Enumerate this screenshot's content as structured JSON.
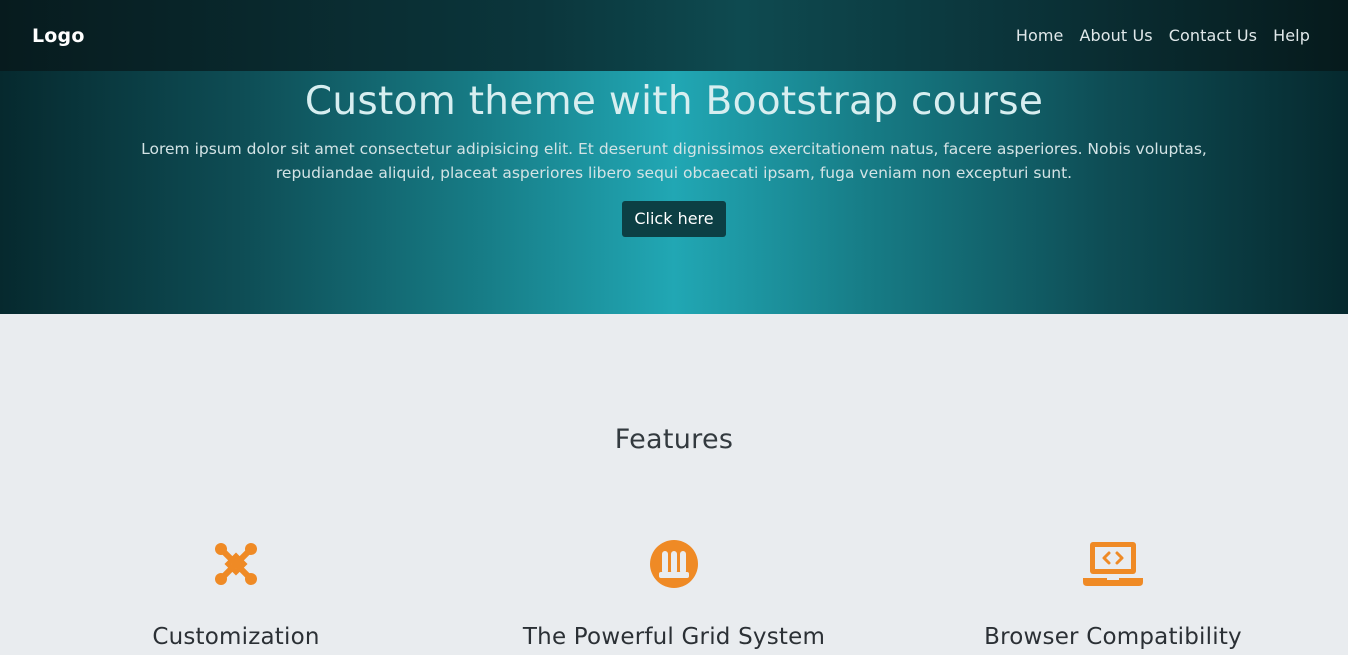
{
  "navbar": {
    "brand": "Logo",
    "links": [
      "Home",
      "About Us",
      "Contact Us",
      "Help"
    ]
  },
  "hero": {
    "title": "Custom theme with Bootstrap course",
    "text": "Lorem ipsum dolor sit amet consectetur adipisicing elit. Et deserunt dignissimos exercitationem natus, facere asperiores. Nobis voluptas, repudiandae aliquid, placeat asperiores libero sequi obcaecati ipsam, fuga veniam non excepturi sunt.",
    "button_label": "Click here"
  },
  "features": {
    "heading": "Features",
    "items": [
      {
        "icon": "joomla-icon",
        "title": "Customization"
      },
      {
        "icon": "grid-circle-icon",
        "title": "The Powerful Grid System"
      },
      {
        "icon": "laptop-code-icon",
        "title": "Browser Compatibility"
      }
    ]
  },
  "colors": {
    "accent": "#ef8a25",
    "hero_center": "#21a7b4",
    "hero_edge": "#06292e",
    "button_bg": "#0c3f44",
    "section_bg": "#e9ecef"
  }
}
